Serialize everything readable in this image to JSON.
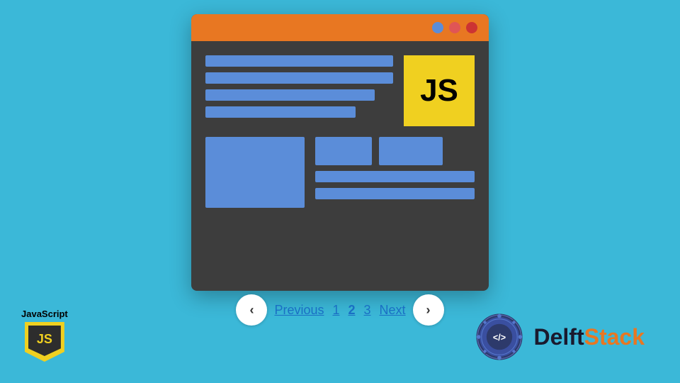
{
  "background": "#3bb8d8",
  "browser": {
    "titlebar_color": "#e87722",
    "dots": [
      {
        "color": "#5b8dd9",
        "label": "blue-dot"
      },
      {
        "color": "#e05555",
        "label": "red-light-dot"
      },
      {
        "color": "#cc3333",
        "label": "red-dot"
      }
    ],
    "js_logo": "JS"
  },
  "pagination": {
    "prev_label": "Previous",
    "next_label": "Next",
    "pages": [
      "1",
      "2",
      "3"
    ],
    "active_page": "2",
    "prev_arrow": "‹",
    "next_arrow": "›"
  },
  "js_corner": {
    "label": "JavaScript",
    "shield_text": "JS"
  },
  "delftstack": {
    "name_part1": "Delft",
    "name_part2": "Stack",
    "code_symbol": "</>",
    "brand_color": "#e87722"
  }
}
